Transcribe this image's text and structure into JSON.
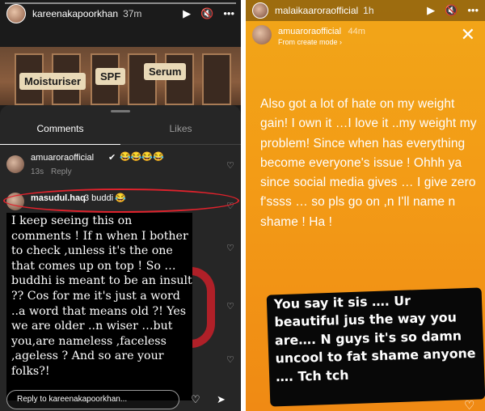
{
  "left_story": {
    "username": "kareenakapoorkhan",
    "time": "37m",
    "controls": {
      "play": "▶",
      "mute": "🔇",
      "more": "•••"
    },
    "tags": [
      "Moisturiser",
      "SPF",
      "Serum"
    ],
    "tabs": {
      "comments": "Comments",
      "likes": "Likes"
    },
    "comment1": {
      "user": "amuaroraofficial",
      "emoji": "😂😂😂😂",
      "time": "13s",
      "reply": "Reply"
    },
    "comment2": {
      "user": "masudul.haq",
      "text": "3 buddi",
      "emoji": "😂"
    },
    "overlay_text": "I keep seeing this on comments ! If n when I bother to check ,unless it's the one that comes up on top ! So …buddhi is meant to be an insult ?? Cos for me it's just a word ..a word that means old ?! Yes we are older ..n wiser …but you,are nameless ,faceless ,ageless ? And so are your folks?!",
    "reply_placeholder": "Reply to kareenakapoorkhan...",
    "heart": "♡",
    "share": "➤"
  },
  "right_story": {
    "username": "malaikaaroraofficial",
    "time": "1h",
    "controls": {
      "play": "▶",
      "mute": "🔇",
      "more": "•••"
    },
    "sub_user": "amuaroraofficial",
    "sub_time": "44m",
    "sub_mode": "From create mode ›",
    "close": "✕",
    "main_text": "Also got a lot of hate on my weight gain! I own it …I love it ..my weight my problem! Since when has everything become everyone's issue ! Ohhh ya since social media gives … I give zero f'ssss … so pls go on ,n I'll name n shame ! Ha !",
    "handwritten_text": "You say it sis …. Ur beautiful jus the way you are…. N guys it's so damn uncool to fat shame anyone …. Tch tch",
    "heart": "♡"
  },
  "colors": {
    "orange": "#f39b16",
    "red_circle": "#e0222c",
    "sheet": "#262626"
  }
}
